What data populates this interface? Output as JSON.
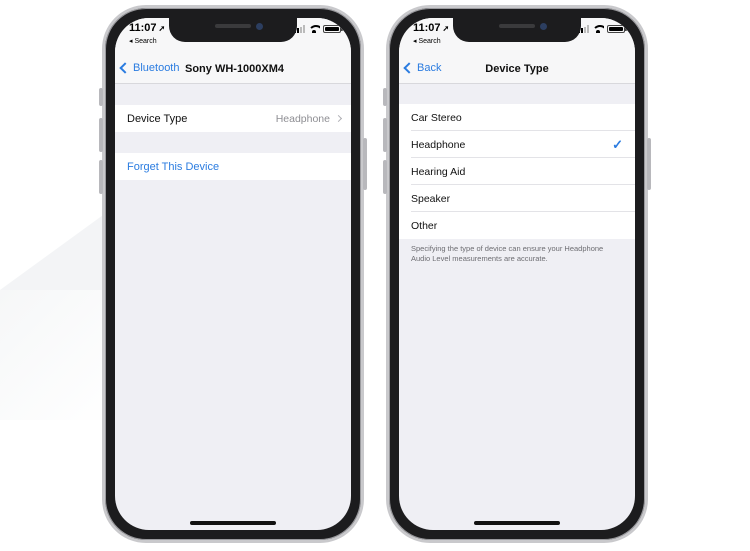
{
  "left_phone": {
    "status": {
      "time": "11:07",
      "back_app": "Search"
    },
    "nav": {
      "back_label": "Bluetooth",
      "title": "Sony WH-1000XM4"
    },
    "device_type_row": {
      "label": "Device Type",
      "value": "Headphone"
    },
    "forget_row": {
      "label": "Forget This Device"
    }
  },
  "right_phone": {
    "status": {
      "time": "11:07",
      "back_app": "Search"
    },
    "nav": {
      "back_label": "Back",
      "title": "Device Type"
    },
    "options": [
      "Car Stereo",
      "Headphone",
      "Hearing Aid",
      "Speaker",
      "Other"
    ],
    "selected_option": "Headphone",
    "footnote": "Specifying the type of device can ensure your Headphone Audio Level measurements are accurate."
  },
  "icons": {
    "location": "location-arrow-icon",
    "signal": "cellular-signal-icon",
    "wifi": "wifi-icon",
    "battery": "battery-icon",
    "back": "chevron-left-icon",
    "disclosure": "chevron-right-icon",
    "checkmark": "checkmark-icon"
  },
  "colors": {
    "accent": "#2b7ce0",
    "grouped_background": "#efeff4",
    "secondary_text": "#8e8e93"
  }
}
